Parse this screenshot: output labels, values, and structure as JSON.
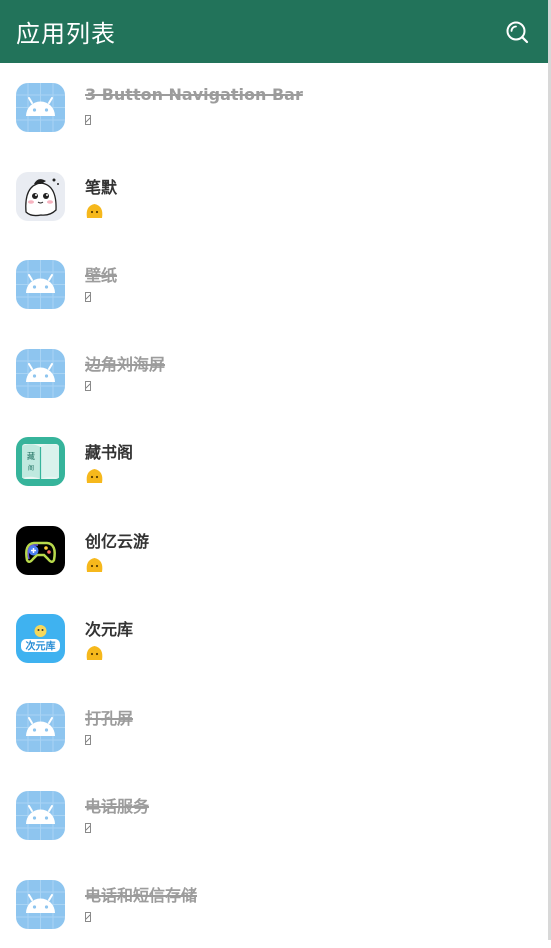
{
  "appbar": {
    "title": "应用列表",
    "action_icon": "search-icon"
  },
  "apps": [
    {
      "name": "3 Button Navigation Bar",
      "enabled": false,
      "icon": "android-icon"
    },
    {
      "name": "笔默",
      "enabled": true,
      "icon": "ghost-character-icon"
    },
    {
      "name": "壁纸",
      "enabled": false,
      "icon": "android-icon"
    },
    {
      "name": "边角刘海屏",
      "enabled": false,
      "icon": "android-icon"
    },
    {
      "name": "藏书阁",
      "enabled": true,
      "icon": "book-icon"
    },
    {
      "name": "创亿云游",
      "enabled": true,
      "icon": "gamepad-icon"
    },
    {
      "name": "次元库",
      "enabled": true,
      "icon": "ciyuanku-logo-icon"
    },
    {
      "name": "打孔屏",
      "enabled": false,
      "icon": "android-icon"
    },
    {
      "name": "电话服务",
      "enabled": false,
      "icon": "android-icon"
    },
    {
      "name": "电话和短信存储",
      "enabled": false,
      "icon": "android-icon"
    }
  ],
  "colors": {
    "appbar": "#22735a",
    "disabled_text": "#9c9c9c",
    "enabled_text": "#333333",
    "status_blob": "#f6b81c",
    "android_tile": "#8ec5ef"
  }
}
